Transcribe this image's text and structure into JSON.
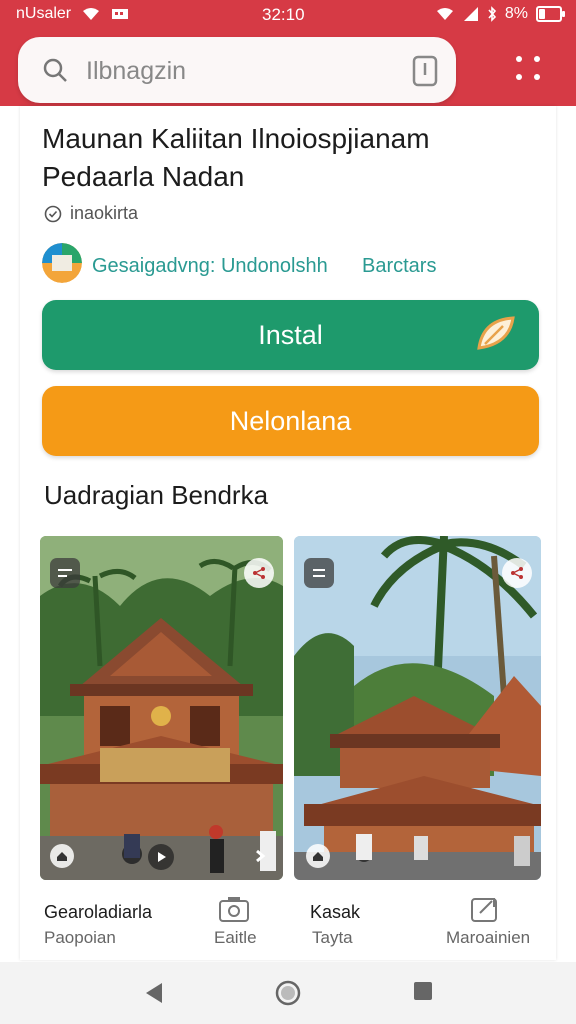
{
  "status": {
    "carrier": "nUsaler",
    "time": "32:10",
    "battery": "8%"
  },
  "search": {
    "value": "Ilbnagzin"
  },
  "app": {
    "title_line1": "Maunan Kaliitan Ilnoiospjianam",
    "title_line2": "Pedaarla Nadan",
    "meta": "inaokirta",
    "publisher": "Gesaigadvng: Undonolshh",
    "publisher_tag": "Barctars"
  },
  "buttons": {
    "install": "Instal",
    "secondary": "Nelonlana"
  },
  "section_title": "Uadragian Bendrka",
  "screenshots": [
    {
      "title": "Gearoladiarla",
      "subtitle": "Paopoian",
      "action": "Eaitle"
    },
    {
      "title": "Kasak",
      "subtitle": "Tayta",
      "action": "Maroainien"
    }
  ],
  "colors": {
    "brand_red": "#d63a45",
    "install_green": "#1e9a6c",
    "secondary_orange": "#f59a16",
    "publisher_teal": "#2a9a92"
  },
  "icons": {
    "search": "search-icon",
    "mic": "mic-icon",
    "menu": "more-vert-icon",
    "verified": "verified-icon",
    "install_badge": "leaf-icon",
    "camera": "camera-icon",
    "share": "share-icon",
    "back": "back-icon",
    "home": "home-icon",
    "recents": "recents-icon"
  }
}
